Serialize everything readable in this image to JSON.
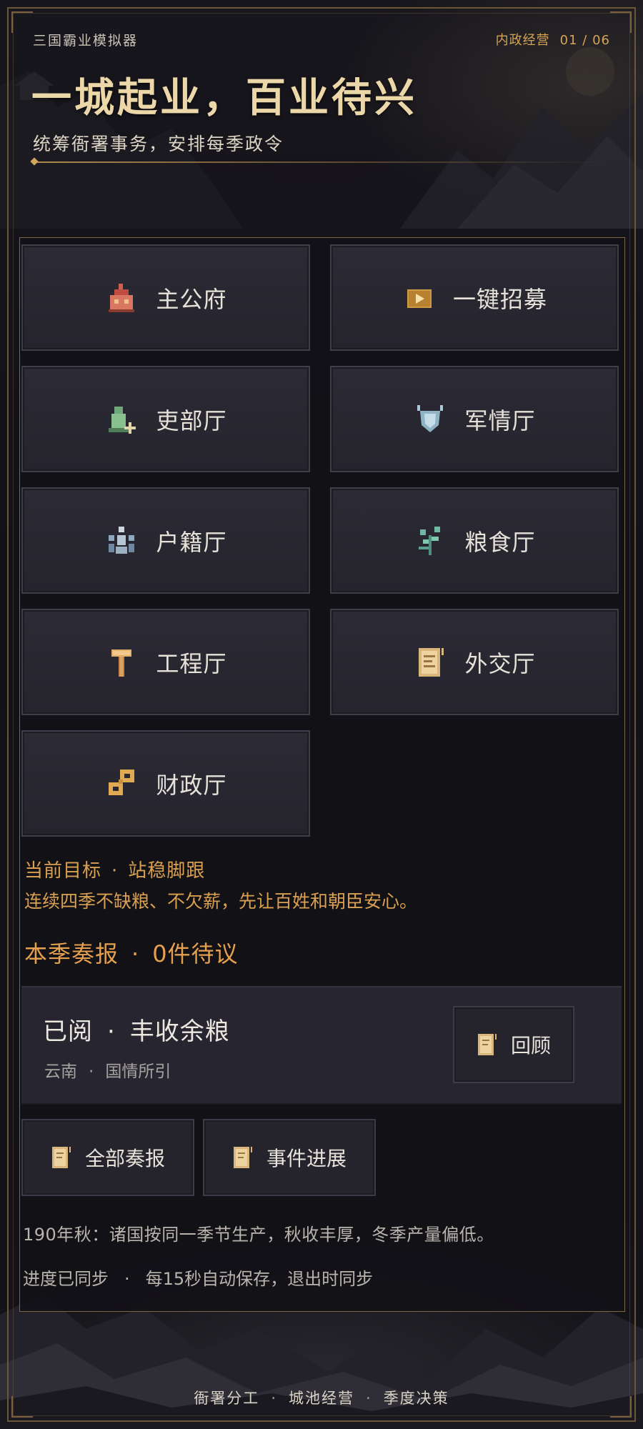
{
  "header": {
    "app_title": "三国霸业模拟器",
    "section": "内政经营",
    "pager": "01 / 06",
    "title": "一城起业，百业待兴",
    "subtitle": "统筹衙署事务，安排每季政令"
  },
  "halls": [
    {
      "label": "主公府",
      "icon": "lord-mansion-icon"
    },
    {
      "label": "一键招募",
      "icon": "recruit-play-icon"
    },
    {
      "label": "吏部厅",
      "icon": "official-add-icon"
    },
    {
      "label": "军情厅",
      "icon": "military-shield-icon"
    },
    {
      "label": "户籍厅",
      "icon": "population-icon"
    },
    {
      "label": "粮食厅",
      "icon": "grain-plant-icon"
    },
    {
      "label": "工程厅",
      "icon": "hammer-icon"
    },
    {
      "label": "外交厅",
      "icon": "scroll-document-icon"
    },
    {
      "label": "财政厅",
      "icon": "coins-icon"
    }
  ],
  "goal": {
    "label": "当前目标",
    "sep": "·",
    "name": "站稳脚跟",
    "description": "连续四季不缺粮、不欠薪，先让百姓和朝臣安心。"
  },
  "reports": {
    "heading": "本季奏报",
    "sep": "·",
    "pending": "0件待议",
    "card": {
      "status": "已阅",
      "sep": "·",
      "title": "丰收余粮",
      "place": "云南",
      "source": "国情所引",
      "review_label": "回顾"
    },
    "all_label": "全部奏报",
    "progress_label": "事件进展"
  },
  "notes": {
    "season": "190年秋：诸国按同一季节生产，秋收丰厚，冬季产量偏低。",
    "sync_status": "进度已同步",
    "sep": "·",
    "autosave": "每15秒自动保存，退出时同步"
  },
  "footer": {
    "items": [
      "衙署分工",
      "城池经营",
      "季度决策"
    ],
    "sep": "·"
  },
  "colors": {
    "gold": "#d9a052",
    "title": "#ecd7a8",
    "button_bg": "#2a2932",
    "frame": "#6b5638"
  }
}
